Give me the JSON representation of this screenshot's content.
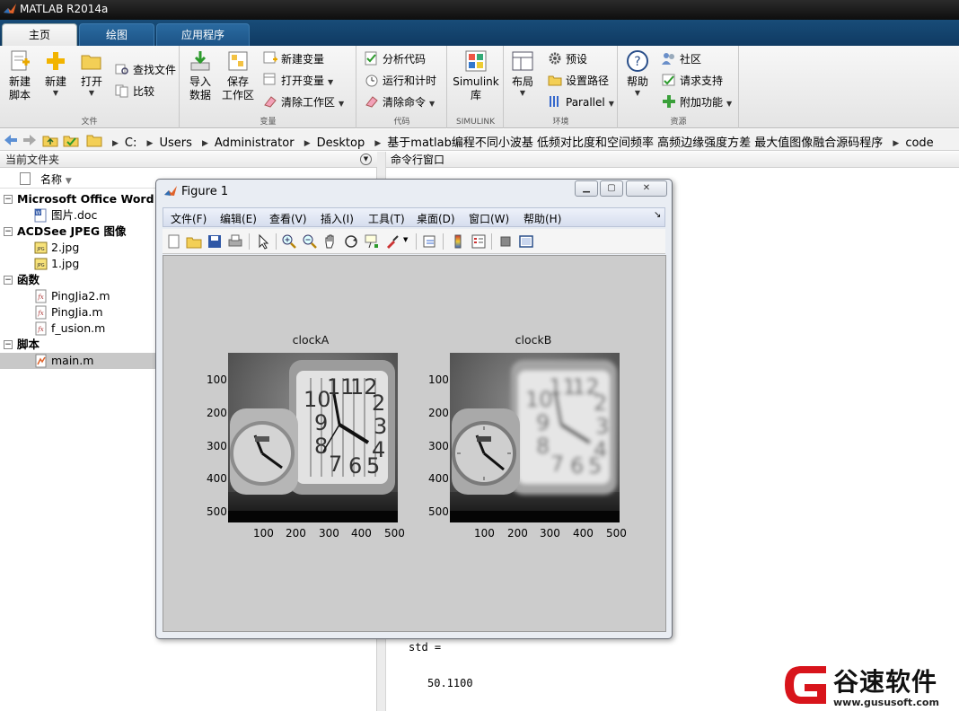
{
  "window": {
    "title": "MATLAB R2014a"
  },
  "tabs": [
    {
      "label": "主页",
      "active": true
    },
    {
      "label": "绘图",
      "active": false
    },
    {
      "label": "应用程序",
      "active": false
    }
  ],
  "ribbon": {
    "file": {
      "group_label": "文件",
      "new_script": "新建\n脚本",
      "new": "新建",
      "open": "打开",
      "find_files": "查找文件",
      "compare": "比较"
    },
    "variable": {
      "group_label": "变量",
      "import_data": "导入\n数据",
      "save_workspace": "保存\n工作区",
      "new_variable": "新建变量",
      "open_variable": "打开变量",
      "clear_workspace": "清除工作区"
    },
    "code": {
      "group_label": "代码",
      "analyze_code": "分析代码",
      "run_and_time": "运行和计时",
      "clear_commands": "清除命令"
    },
    "simulink": {
      "group_label": "SIMULINK",
      "simulink_lib": "Simulink\n库"
    },
    "environment": {
      "group_label": "环境",
      "layout": "布局",
      "preferences": "预设",
      "set_path": "设置路径",
      "parallel": "Parallel"
    },
    "resources": {
      "group_label": "资源",
      "help": "帮助",
      "community": "社区",
      "request_support": "请求支持",
      "addons": "附加功能"
    }
  },
  "address": {
    "crumbs": [
      "C:",
      "Users",
      "Administrator",
      "Desktop",
      "基于matlab编程不同小波基 低频对比度和空间频率 高频边缘强度方差 最大值图像融合源码程序",
      "code"
    ]
  },
  "current_folder": {
    "title": "当前文件夹",
    "name_column": "名称",
    "groups": [
      {
        "label": "Microsoft Office Word 97",
        "files": [
          "图片.doc"
        ]
      },
      {
        "label": "ACDSee JPEG 图像",
        "files": [
          "2.jpg",
          "1.jpg"
        ]
      },
      {
        "label": "函数",
        "files": [
          "PingJia2.m",
          "PingJia.m",
          "f_usion.m"
        ]
      },
      {
        "label": "脚本",
        "files": [
          "main.m"
        ]
      }
    ],
    "selected_file": "main.m"
  },
  "command_window": {
    "title": "命令行窗口",
    "var_line": "std =",
    "value_line": "50.1100"
  },
  "figure": {
    "title": "Figure 1",
    "menus": [
      "文件(F)",
      "编辑(E)",
      "查看(V)",
      "插入(I)",
      "工具(T)",
      "桌面(D)",
      "窗口(W)",
      "帮助(H)"
    ],
    "axes": [
      {
        "title": "clockA",
        "xticks": [
          "100",
          "200",
          "300",
          "400",
          "500"
        ],
        "yticks": [
          "100",
          "200",
          "300",
          "400",
          "500"
        ]
      },
      {
        "title": "clockB",
        "xticks": [
          "100",
          "200",
          "300",
          "400",
          "500"
        ],
        "yticks": [
          "100",
          "200",
          "300",
          "400",
          "500"
        ]
      }
    ]
  },
  "watermark": {
    "brand": "谷速软件",
    "url": "www.gususoft.com"
  }
}
